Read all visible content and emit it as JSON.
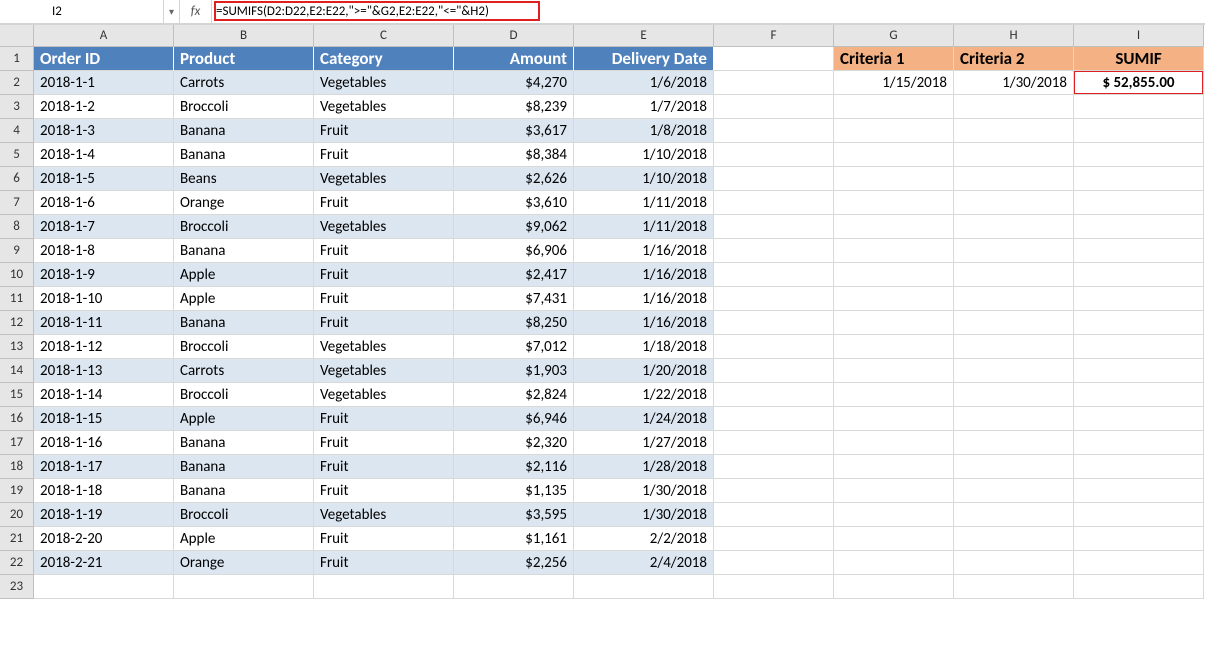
{
  "namebox": "I2",
  "fx": "fx",
  "formula": "=SUMIFS(D2:D22,E2:E22,\">=\"&G2,E2:E22,\"<=\"&H2)",
  "columns": [
    "A",
    "B",
    "C",
    "D",
    "E",
    "F",
    "G",
    "H",
    "I"
  ],
  "row_numbers": [
    "1",
    "2",
    "3",
    "4",
    "5",
    "6",
    "7",
    "8",
    "9",
    "10",
    "11",
    "12",
    "13",
    "14",
    "15",
    "16",
    "17",
    "18",
    "19",
    "20",
    "21",
    "22",
    "23"
  ],
  "headers": {
    "order_id": "Order ID",
    "product": "Product",
    "category": "Category",
    "amount": "Amount",
    "delivery_date": "Delivery Date",
    "criteria1": "Criteria 1",
    "criteria2": "Criteria 2",
    "sumif": "SUMIF"
  },
  "criteria": {
    "c1": "1/15/2018",
    "c2": "1/30/2018",
    "result": "$   52,855.00"
  },
  "rows": [
    {
      "id": "2018-1-1",
      "product": "Carrots",
      "category": "Vegetables",
      "amount": "$4,270",
      "date": "1/6/2018"
    },
    {
      "id": "2018-1-2",
      "product": "Broccoli",
      "category": "Vegetables",
      "amount": "$8,239",
      "date": "1/7/2018"
    },
    {
      "id": "2018-1-3",
      "product": "Banana",
      "category": "Fruit",
      "amount": "$3,617",
      "date": "1/8/2018"
    },
    {
      "id": "2018-1-4",
      "product": "Banana",
      "category": "Fruit",
      "amount": "$8,384",
      "date": "1/10/2018"
    },
    {
      "id": "2018-1-5",
      "product": "Beans",
      "category": "Vegetables",
      "amount": "$2,626",
      "date": "1/10/2018"
    },
    {
      "id": "2018-1-6",
      "product": "Orange",
      "category": "Fruit",
      "amount": "$3,610",
      "date": "1/11/2018"
    },
    {
      "id": "2018-1-7",
      "product": "Broccoli",
      "category": "Vegetables",
      "amount": "$9,062",
      "date": "1/11/2018"
    },
    {
      "id": "2018-1-8",
      "product": "Banana",
      "category": "Fruit",
      "amount": "$6,906",
      "date": "1/16/2018"
    },
    {
      "id": "2018-1-9",
      "product": "Apple",
      "category": "Fruit",
      "amount": "$2,417",
      "date": "1/16/2018"
    },
    {
      "id": "2018-1-10",
      "product": "Apple",
      "category": "Fruit",
      "amount": "$7,431",
      "date": "1/16/2018"
    },
    {
      "id": "2018-1-11",
      "product": "Banana",
      "category": "Fruit",
      "amount": "$8,250",
      "date": "1/16/2018"
    },
    {
      "id": "2018-1-12",
      "product": "Broccoli",
      "category": "Vegetables",
      "amount": "$7,012",
      "date": "1/18/2018"
    },
    {
      "id": "2018-1-13",
      "product": "Carrots",
      "category": "Vegetables",
      "amount": "$1,903",
      "date": "1/20/2018"
    },
    {
      "id": "2018-1-14",
      "product": "Broccoli",
      "category": "Vegetables",
      "amount": "$2,824",
      "date": "1/22/2018"
    },
    {
      "id": "2018-1-15",
      "product": "Apple",
      "category": "Fruit",
      "amount": "$6,946",
      "date": "1/24/2018"
    },
    {
      "id": "2018-1-16",
      "product": "Banana",
      "category": "Fruit",
      "amount": "$2,320",
      "date": "1/27/2018"
    },
    {
      "id": "2018-1-17",
      "product": "Banana",
      "category": "Fruit",
      "amount": "$2,116",
      "date": "1/28/2018"
    },
    {
      "id": "2018-1-18",
      "product": "Banana",
      "category": "Fruit",
      "amount": "$1,135",
      "date": "1/30/2018"
    },
    {
      "id": "2018-1-19",
      "product": "Broccoli",
      "category": "Vegetables",
      "amount": "$3,595",
      "date": "1/30/2018"
    },
    {
      "id": "2018-2-20",
      "product": "Apple",
      "category": "Fruit",
      "amount": "$1,161",
      "date": "2/2/2018"
    },
    {
      "id": "2018-2-21",
      "product": "Orange",
      "category": "Fruit",
      "amount": "$2,256",
      "date": "2/4/2018"
    }
  ]
}
